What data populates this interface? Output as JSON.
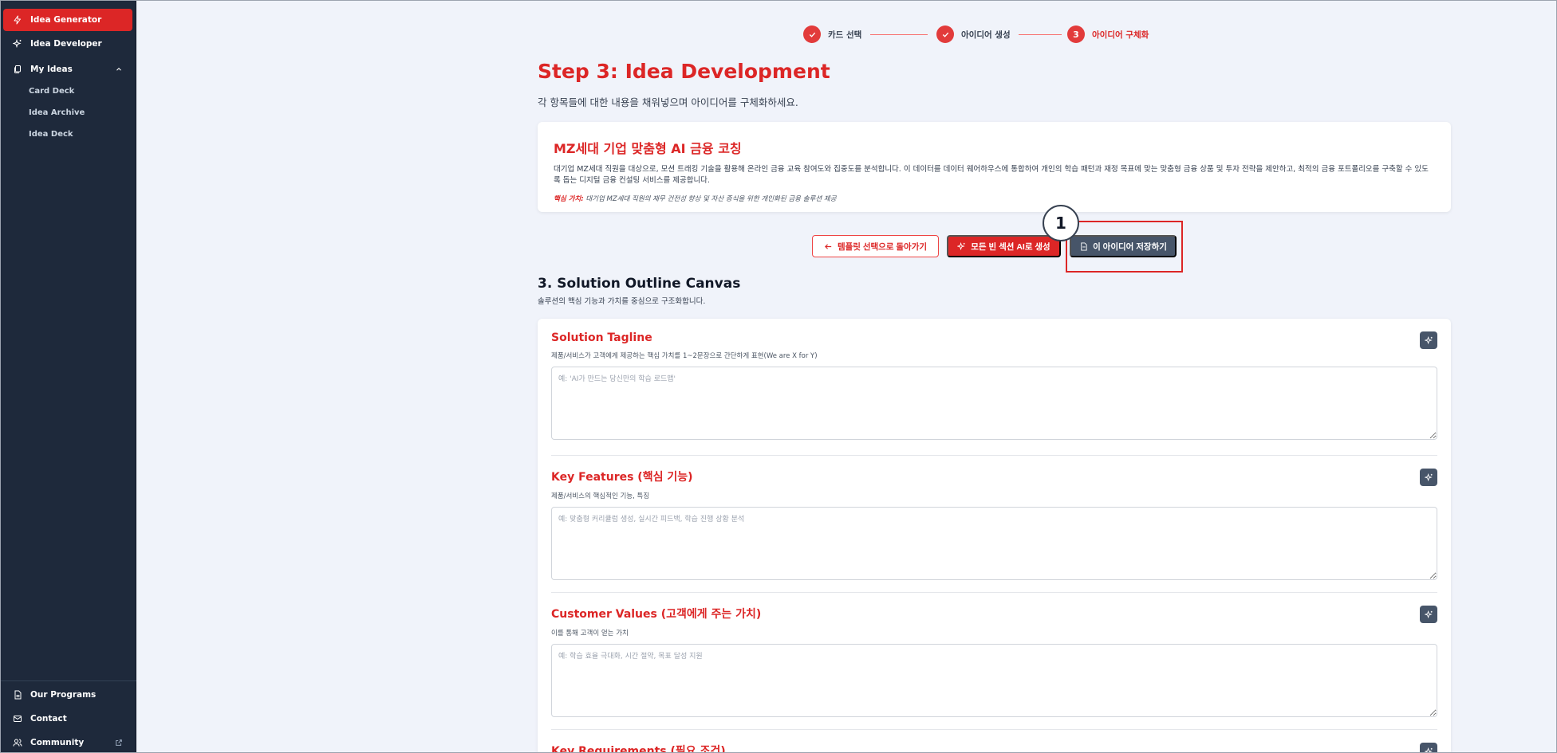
{
  "sidebar": {
    "items": [
      {
        "label": "Idea Generator",
        "icon": "bolt-icon"
      },
      {
        "label": "Idea Developer",
        "icon": "sparkle-icon"
      },
      {
        "label": "My Ideas",
        "icon": "documents-icon"
      }
    ],
    "subitems": [
      "Card Deck",
      "Idea Archive",
      "Idea Deck"
    ],
    "bottom": [
      {
        "label": "Our Programs",
        "icon": "document-icon"
      },
      {
        "label": "Contact",
        "icon": "mail-icon"
      },
      {
        "label": "Community",
        "icon": "users-icon"
      }
    ]
  },
  "stepper": {
    "steps": [
      {
        "label": "카드 선택",
        "state": "done"
      },
      {
        "label": "아이디어 생성",
        "state": "done"
      },
      {
        "label": "아이디어 구체화",
        "state": "current",
        "number": "3"
      }
    ]
  },
  "page": {
    "title": "Step 3: Idea Development",
    "subtitle": "각 항목들에 대한 내용을 채워넣으며 아이디어를 구체화하세요."
  },
  "idea": {
    "title": "MZ세대 기업 맞춤형 AI 금융 코칭",
    "description": "대기업 MZ세대 직원을 대상으로, 모션 트래킹 기술을 활용해 온라인 금융 교육 참여도와 집중도를 분석합니다. 이 데이터를 데이터 웨어하우스에 통합하여 개인의 학습 패턴과 재정 목표에 맞는 맞춤형 금융 상품 및 투자 전략을 제안하고, 최적의 금융 포트폴리오를 구축할 수 있도록 돕는 디지털 금융 컨설팅 서비스를 제공합니다.",
    "value_label": "핵심 가치:",
    "value_text": "대기업 MZ세대 직원의 재무 건전성 향상 및 자산 증식을 위한 개인화된 금융 솔루션 제공"
  },
  "actions": {
    "back": "템플릿 선택으로 돌아가기",
    "generate": "모든 빈 섹션 AI로 생성",
    "save": "이 아이디어 저장하기",
    "badge": "1"
  },
  "section": {
    "title": "3. Solution Outline Canvas",
    "subtitle": "솔루션의 핵심 기능과 가치를 중심으로 구조화합니다."
  },
  "fields": [
    {
      "title": "Solution Tagline",
      "desc": "제품/서비스가 고객에게 제공하는 핵심 가치를 1~2문장으로 간단하게 표현(We are X for Y)",
      "placeholder": "예: 'AI가 만드는 당신만의 학습 로드맵'"
    },
    {
      "title": "Key Features (핵심 기능)",
      "desc": "제품/서비스의 핵심적인 기능, 특징",
      "placeholder": "예: 맞춤형 커리큘럼 생성, 실시간 피드백, 학습 진행 상황 분석"
    },
    {
      "title": "Customer Values (고객에게 주는 가치)",
      "desc": "이를 통해 고객이 얻는 가치",
      "placeholder": "예: 학습 효율 극대화, 시간 절약, 목표 달성 지원"
    },
    {
      "title": "Key Requirements (필요 조건)",
      "desc": "",
      "placeholder": ""
    }
  ],
  "colors": {
    "accent": "#dc2626",
    "sidebar": "#1e293b",
    "slate": "#475569"
  }
}
